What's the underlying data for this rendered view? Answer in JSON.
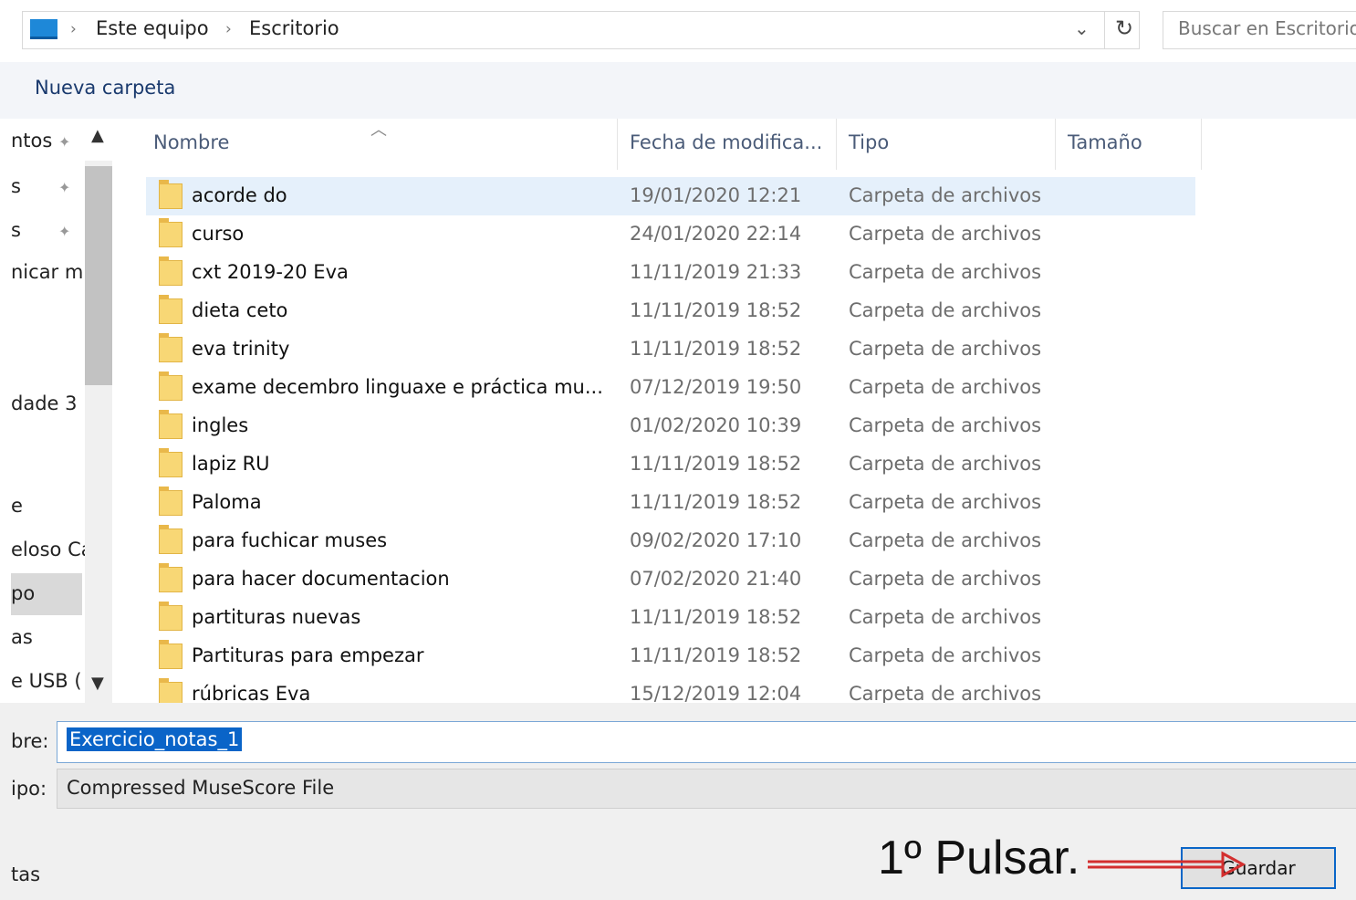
{
  "breadcrumb": {
    "items": [
      "Este equipo",
      "Escritorio"
    ],
    "separator": "›"
  },
  "search": {
    "placeholder": "Buscar en Escritorio"
  },
  "toolbar": {
    "new_folder_label": "Nueva carpeta"
  },
  "nav_pane": {
    "items": [
      "ntos",
      "s",
      "s",
      "nicar mu",
      "dade 3",
      "e",
      "eloso Ca",
      "po",
      "as",
      "e USB ("
    ]
  },
  "file_list": {
    "columns": [
      "Nombre",
      "Fecha de modifica...",
      "Tipo",
      "Tamaño"
    ],
    "rows": [
      {
        "name": "acorde do",
        "date": "19/01/2020 12:21",
        "type": "Carpeta de archivos"
      },
      {
        "name": "curso",
        "date": "24/01/2020 22:14",
        "type": "Carpeta de archivos"
      },
      {
        "name": "cxt 2019-20 Eva",
        "date": "11/11/2019 21:33",
        "type": "Carpeta de archivos"
      },
      {
        "name": "dieta ceto",
        "date": "11/11/2019 18:52",
        "type": "Carpeta de archivos"
      },
      {
        "name": "eva trinity",
        "date": "11/11/2019 18:52",
        "type": "Carpeta de archivos"
      },
      {
        "name": "exame decembro linguaxe e práctica mu...",
        "date": "07/12/2019 19:50",
        "type": "Carpeta de archivos"
      },
      {
        "name": "ingles",
        "date": "01/02/2020 10:39",
        "type": "Carpeta de archivos"
      },
      {
        "name": "lapiz RU",
        "date": "11/11/2019 18:52",
        "type": "Carpeta de archivos"
      },
      {
        "name": "Paloma",
        "date": "11/11/2019 18:52",
        "type": "Carpeta de archivos"
      },
      {
        "name": "para fuchicar muses",
        "date": "09/02/2020 17:10",
        "type": "Carpeta de archivos"
      },
      {
        "name": "para hacer documentacion",
        "date": "07/02/2020 21:40",
        "type": "Carpeta de archivos"
      },
      {
        "name": "partituras nuevas",
        "date": "11/11/2019 18:52",
        "type": "Carpeta de archivos"
      },
      {
        "name": "Partituras para empezar",
        "date": "11/11/2019 18:52",
        "type": "Carpeta de archivos"
      },
      {
        "name": "rúbricas Eva",
        "date": "15/12/2019 12:04",
        "type": "Carpeta de archivos"
      }
    ]
  },
  "form": {
    "filename_label": "bre:",
    "filename_value": "Exercicio_notas_1",
    "filetype_label": "ipo:",
    "filetype_value": "Compressed MuseScore File",
    "tags_label": "tas"
  },
  "actions": {
    "save_label": "Guardar"
  },
  "annotation": {
    "text": "1º Pulsar."
  },
  "colors": {
    "accent": "#0a64c8",
    "selected_row": "#e5f0fb",
    "annotation_arrow": "#d32f2f"
  },
  "icons": [
    "computer-icon",
    "chevron-right-icon",
    "chevron-down-icon",
    "refresh-icon",
    "pin-icon",
    "folder-icon",
    "sort-up-icon"
  ]
}
